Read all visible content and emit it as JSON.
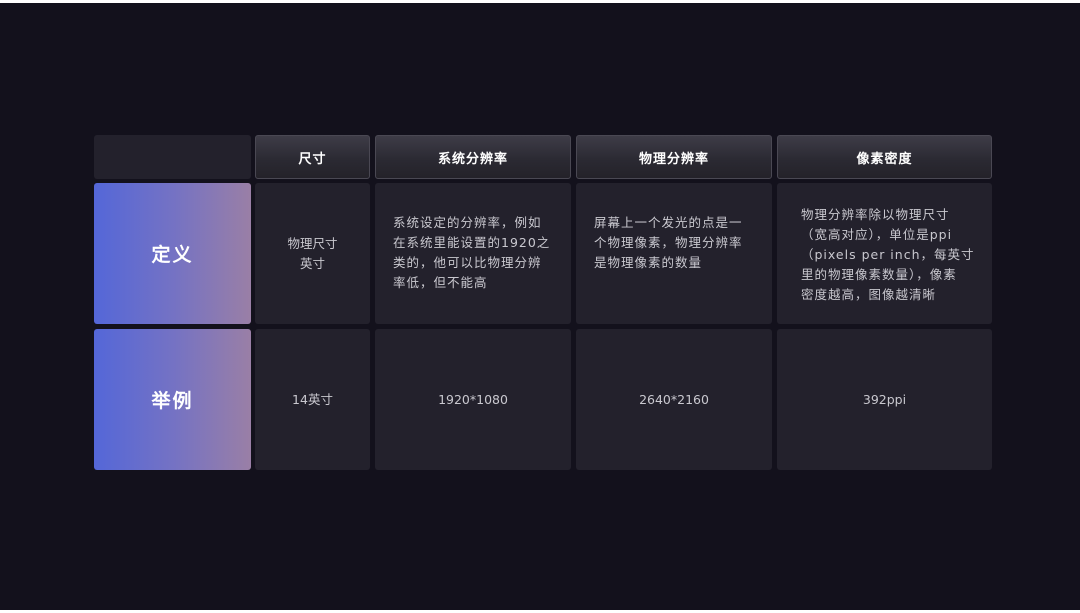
{
  "table": {
    "headers": [
      "尺寸",
      "系统分辨率",
      "物理分辨率",
      "像素密度"
    ],
    "rows": [
      {
        "label": "定义",
        "cells": [
          "物理尺寸\n英寸",
          "系统设定的分辨率，例如\n在系统里能设置的1920之\n类的，他可以比物理分辨\n率低，但不能高",
          "屏幕上一个发光的点是一\n个物理像素，物理分辨率\n是物理像素的数量",
          "物理分辨率除以物理尺寸\n（宽高对应），单位是ppi\n（pixels per inch，每英寸\n里的物理像素数量），像素\n密度越高，图像越清晰"
        ]
      },
      {
        "label": "举例",
        "cells": [
          "14英寸",
          "1920*1080",
          "2640*2160",
          "392ppi"
        ]
      }
    ]
  },
  "colors": {
    "background": "#13111c",
    "cell": "#23212c",
    "row_header_gradient_start": "#5467d8",
    "row_header_gradient_end": "#9a7fa6"
  }
}
